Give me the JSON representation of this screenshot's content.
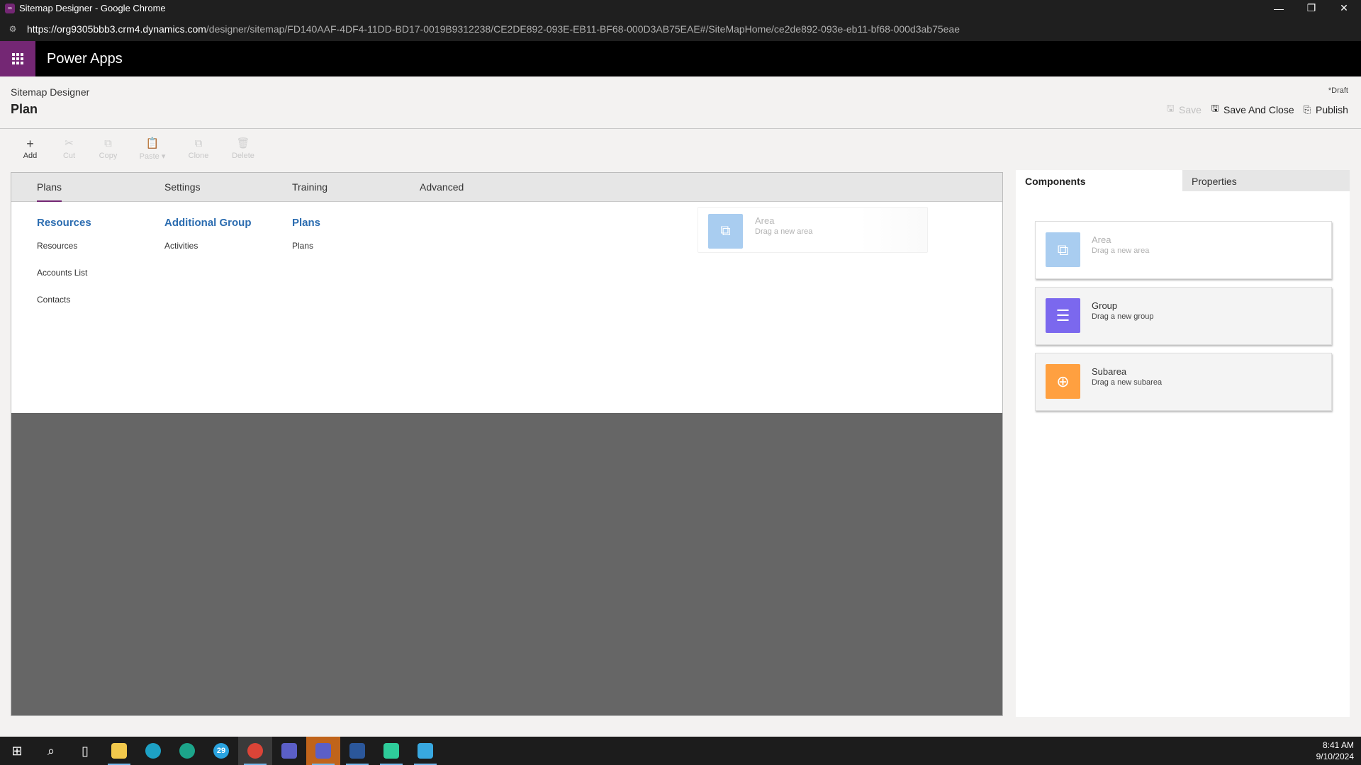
{
  "browser": {
    "window_title": "Sitemap Designer - Google Chrome",
    "url_host": "https://org9305bbb3.crm4.dynamics.com",
    "url_path": "/designer/sitemap/FD140AAF-4DF4-11DD-BD17-0019B9312238/CE2DE892-093E-EB11-BF68-000D3AB75EAE#/SiteMapHome/ce2de892-093e-eb11-bf68-000d3ab75eae"
  },
  "app": {
    "name": "Power Apps"
  },
  "header": {
    "subtitle": "Sitemap Designer",
    "title": "Plan",
    "status": "*Draft",
    "save_label": "Save",
    "save_close_label": "Save And Close",
    "publish_label": "Publish"
  },
  "toolbar": {
    "add": "Add",
    "cut": "Cut",
    "copy": "Copy",
    "paste": "Paste",
    "clone": "Clone",
    "delete": "Delete"
  },
  "canvas": {
    "areas": [
      {
        "label": "Plans"
      },
      {
        "label": "Settings"
      },
      {
        "label": "Training"
      },
      {
        "label": "Advanced"
      }
    ],
    "groups": [
      {
        "title": "Resources",
        "subareas": [
          "Resources",
          "Accounts List",
          "Contacts"
        ]
      },
      {
        "title": "Additional Group",
        "subareas": [
          "Activities"
        ]
      },
      {
        "title": "Plans",
        "subareas": [
          "Plans"
        ]
      }
    ],
    "ghost_area": {
      "name": "Area",
      "desc": "Drag a new area"
    }
  },
  "panel": {
    "tab_components": "Components",
    "tab_properties": "Properties",
    "components": [
      {
        "name": "Area",
        "desc": "Drag a new area",
        "color": "#a9cdf0"
      },
      {
        "name": "Group",
        "desc": "Drag a new group",
        "color": "#7b68ee"
      },
      {
        "name": "Subarea",
        "desc": "Drag a new subarea",
        "color": "#ffa040"
      }
    ]
  },
  "taskbar": {
    "time": "8:41 AM",
    "date": "9/10/2024",
    "telegram_badge": "29"
  }
}
